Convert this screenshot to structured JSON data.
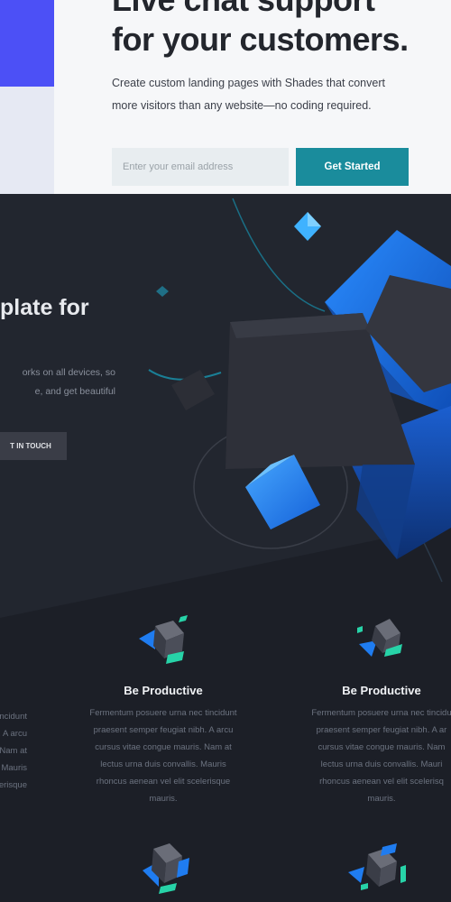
{
  "hero": {
    "title_line1": "Live chat support",
    "title_line2": "for your customers.",
    "subtitle_line1": "Create custom landing pages with Shades that convert",
    "subtitle_line2": "more visitors than any website—no coding required.",
    "email_placeholder": "Enter your email address",
    "cta_label": "Get Started"
  },
  "dark_hero": {
    "title": "plate for",
    "desc_line1": "orks on all devices, so",
    "desc_line2": "e, and get beautiful",
    "button_label": "T IN TOUCH"
  },
  "features": [
    {
      "icon": "cube-icon",
      "title": "Be Productive",
      "lines": [
        "Fermentum posuere urna nec tincidunt",
        "praesent semper feugiat nibh. A arcu",
        "cursus vitae congue mauris. Nam at",
        "lectus urna duis convallis. Mauris",
        "rhoncus aenean vel elit scelerisque",
        "mauris."
      ]
    },
    {
      "icon": "cube-icon",
      "title": "Be Productive",
      "lines": [
        "Fermentum posuere urna nec tincidu",
        "praesent semper feugiat nibh. A ar",
        "cursus vitae congue mauris. Nam",
        "lectus urna duis convallis. Mauri",
        "rhoncus aenean vel elit scelerisq",
        "mauris."
      ]
    }
  ],
  "feature_left_partial": [
    "tincidunt",
    "nibh. A arcu",
    "uris. Nam at",
    "allis. Mauris",
    "scelerisque"
  ],
  "colors": {
    "accent_teal": "#1a8c9c",
    "brand_blue": "#4c50f6",
    "dark_bg": "#1c1f27",
    "cube_blue": "#1f7cf0"
  }
}
